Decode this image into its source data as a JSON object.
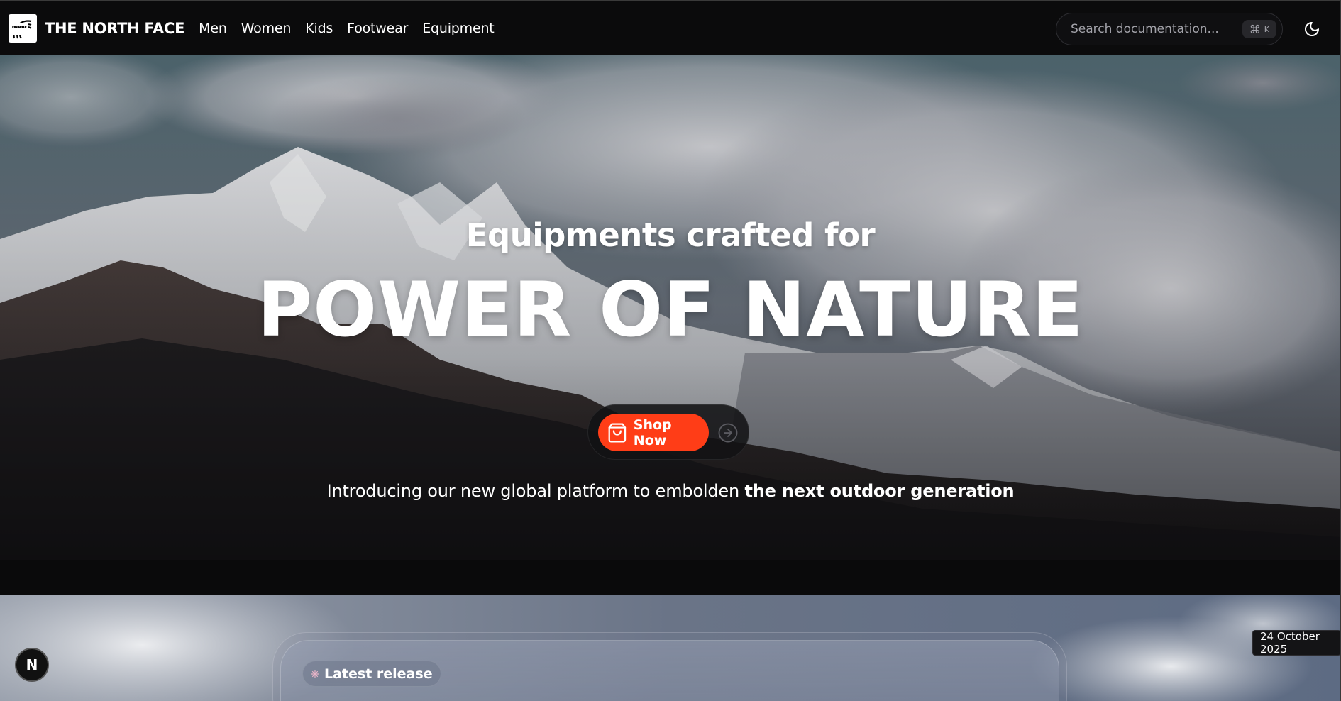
{
  "navbar": {
    "brand_name": "THE NORTH FACE",
    "logo_text": "THE NORTH FACE",
    "links": [
      "Men",
      "Women",
      "Kids",
      "Footwear",
      "Equipment"
    ],
    "search_placeholder": "Search documentation...",
    "shortcut_symbol": "⌘",
    "shortcut_key": "K",
    "theme_icon": "moon-icon"
  },
  "hero": {
    "subtitle": "Equipments crafted for",
    "title": "POWER OF NATURE",
    "cta_label": "Shop Now",
    "cta_icon": "shopping-bag-icon",
    "arrow_icon": "arrow-right-circle-icon",
    "tagline_regular": "Introducing our new global platform to embolden ",
    "tagline_bold": "the next outdoor generation"
  },
  "release": {
    "badge_label": "Latest release",
    "badge_icon": "sparkle-icon"
  },
  "floating": {
    "next_badge_letter": "N",
    "date_tag": "24 October 2025"
  },
  "colors": {
    "accent": "#ff3d17",
    "navbar_bg": "#0b0b0c",
    "page_bg": "#0a0a0b"
  }
}
